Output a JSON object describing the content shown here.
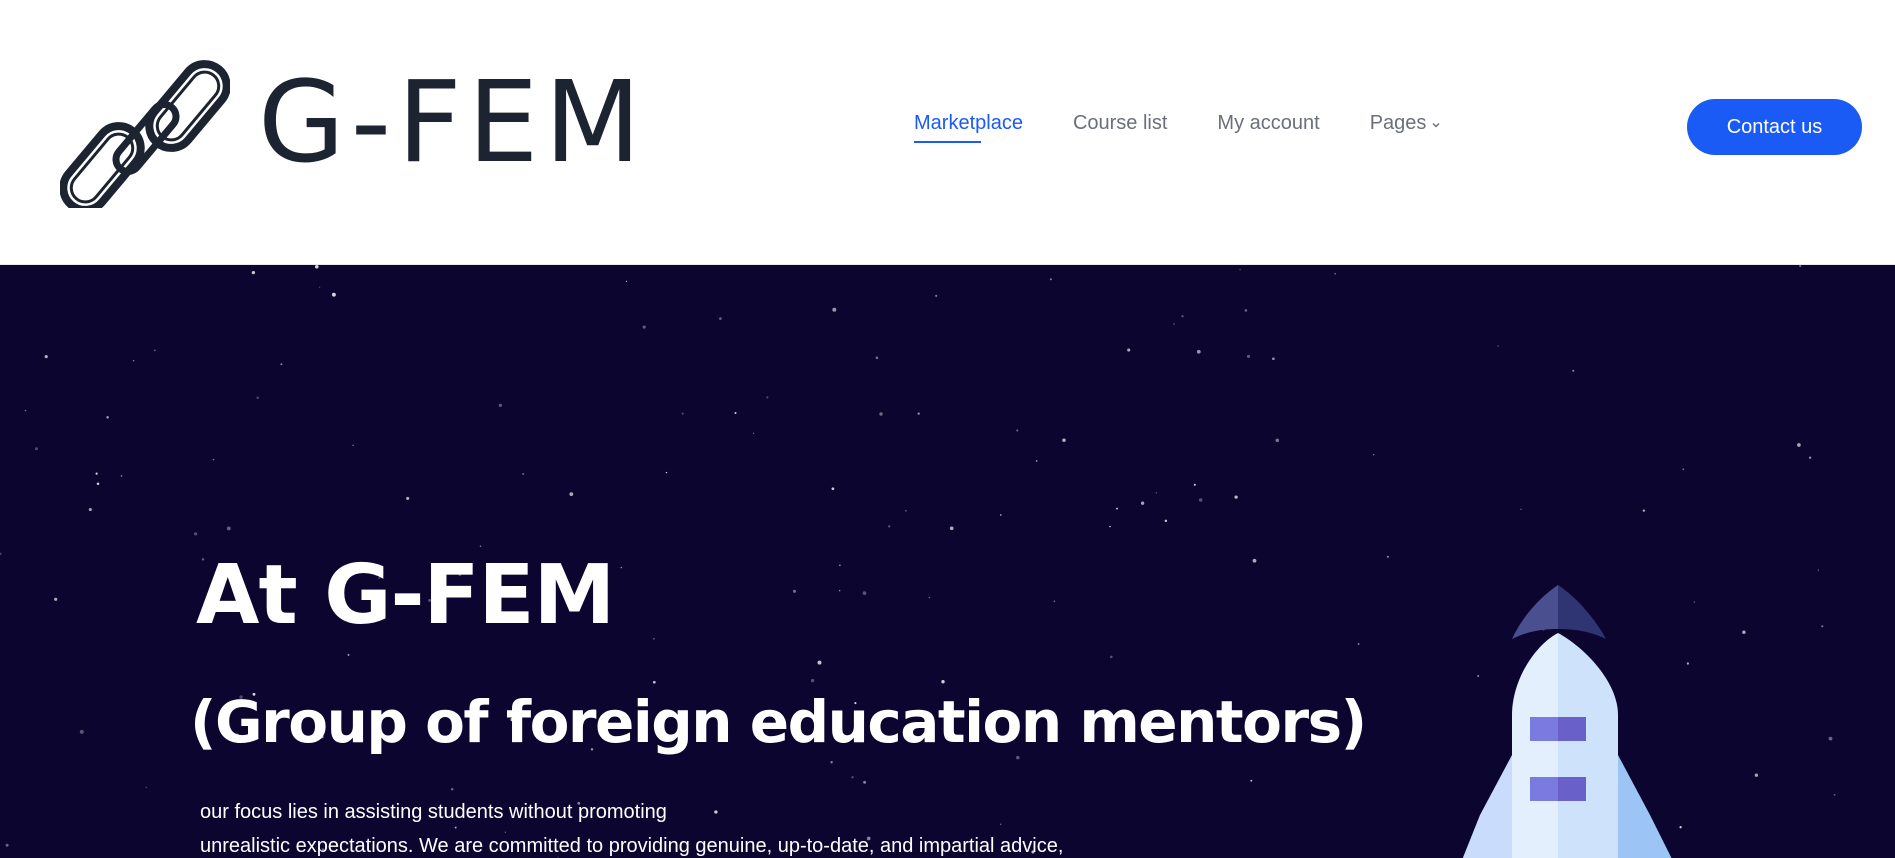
{
  "header": {
    "logo_text": "G-FEM",
    "nav": [
      {
        "label": "Marketplace",
        "active": true
      },
      {
        "label": "Course list",
        "active": false
      },
      {
        "label": "My account",
        "active": false
      },
      {
        "label": "Pages",
        "active": false,
        "has_dropdown": true
      }
    ],
    "contact_button": "Contact us"
  },
  "hero": {
    "title": "At G-FEM",
    "subtitle": "(Group of foreign education mentors)",
    "description_lines": [
      "our focus lies in assisting students without promoting",
      "unrealistic expectations. We are committed to providing genuine, up-to-date, and impartial advice,"
    ]
  },
  "colors": {
    "accent": "#1a5af5",
    "hero_background": "#0c0530",
    "logo_text": "#1c2331",
    "nav_text": "#6b6f7b"
  },
  "icons": [
    "chain-link-icon",
    "chevron-down-icon",
    "rocket-illustration"
  ]
}
